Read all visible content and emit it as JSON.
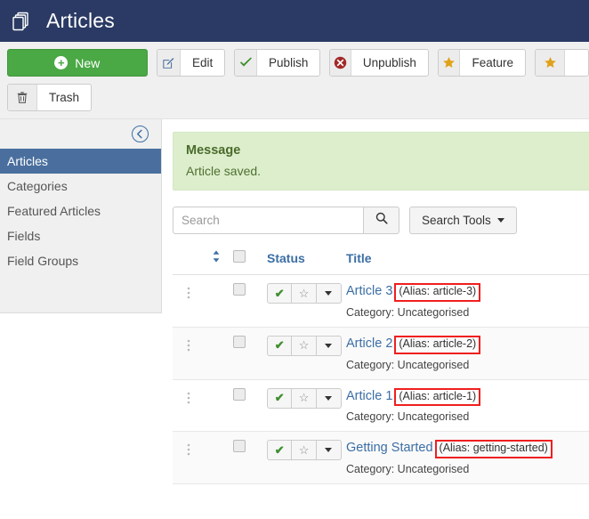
{
  "header": {
    "title": "Articles",
    "icon": "copy-stack-icon",
    "bg_color": "#2a3a64"
  },
  "toolbar": {
    "rows": [
      [
        {
          "name": "new",
          "label": "New",
          "icon": "plus-circle-icon",
          "style": "primary-green",
          "color": "#4aa845"
        },
        {
          "name": "edit",
          "label": "Edit",
          "icon": "pencil-square-icon"
        },
        {
          "name": "publish",
          "label": "Publish",
          "icon": "check-icon",
          "icon_color": "#3f8f2f"
        },
        {
          "name": "unpublish",
          "label": "Unpublish",
          "icon": "times-circle-icon",
          "icon_color": "#a32929"
        },
        {
          "name": "feature",
          "label": "Feature",
          "icon": "star-filled-icon",
          "icon_color": "#e0a21a"
        },
        {
          "name": "cut-off",
          "label": "",
          "icon": "star-icon",
          "icon_color": "#e0a21a",
          "truncated": true
        }
      ],
      [
        {
          "name": "trash",
          "label": "Trash",
          "icon": "trash-icon"
        }
      ]
    ]
  },
  "sidebar": {
    "collapse_icon": "circle-arrow-left-icon",
    "active_color": "#4a6f9e",
    "items": [
      {
        "label": "Articles",
        "active": true
      },
      {
        "label": "Categories",
        "active": false
      },
      {
        "label": "Featured Articles",
        "active": false
      },
      {
        "label": "Fields",
        "active": false
      },
      {
        "label": "Field Groups",
        "active": false
      }
    ]
  },
  "alert": {
    "title": "Message",
    "text": "Article saved.",
    "bg_color": "#ddeecd",
    "text_color": "#4f7030"
  },
  "search": {
    "value": "",
    "placeholder": "Search",
    "search_icon": "magnifier-icon",
    "tools_label": "Search Tools",
    "tools_caret": "chevron-down-icon"
  },
  "table": {
    "columns": [
      {
        "key": "handle",
        "label": ""
      },
      {
        "key": "sort",
        "label": "",
        "icon": "sort-updown-icon"
      },
      {
        "key": "checkall",
        "label": "",
        "icon": "checkbox-icon"
      },
      {
        "key": "status",
        "label": "Status"
      },
      {
        "key": "title",
        "label": "Title"
      }
    ],
    "rows": [
      {
        "title": "Article 3",
        "alias": "(Alias: article-3)",
        "category": "Category: Uncategorised",
        "published": true,
        "featured": false
      },
      {
        "title": "Article 2",
        "alias": "(Alias: article-2)",
        "category": "Category: Uncategorised",
        "published": true,
        "featured": false
      },
      {
        "title": "Article 1",
        "alias": "(Alias: article-1)",
        "category": "Category: Uncategorised",
        "published": true,
        "featured": false
      },
      {
        "title": "Getting Started",
        "alias": "(Alias: getting-started)",
        "category": "Category: Uncategorised",
        "published": true,
        "featured": false
      }
    ],
    "highlight_color": "#ef1f1f"
  }
}
